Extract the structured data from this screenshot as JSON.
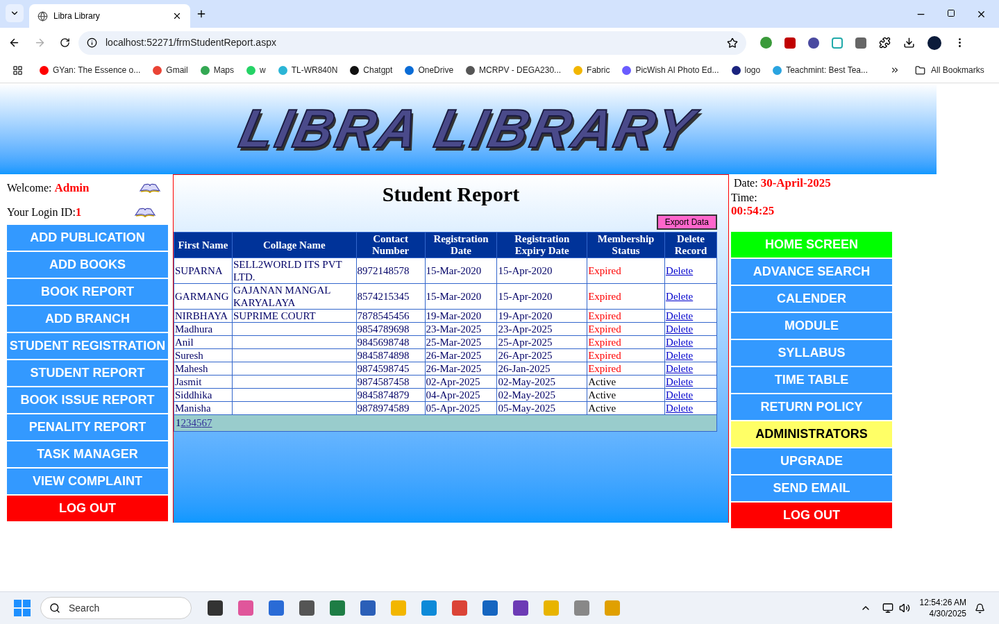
{
  "browser": {
    "tab_title": "Libra Library",
    "url": "localhost:52271/frmStudentReport.aspx",
    "bookmarks": [
      "GYan: The Essence o...",
      "Gmail",
      "Maps",
      "w",
      "TL-WR840N",
      "Chatgpt",
      "OneDrive",
      "MCRPV - DEGA230...",
      "Fabric",
      "PicWish AI Photo Ed...",
      "logo",
      "Teachmint: Best Tea..."
    ],
    "all_bookmarks": "All Bookmarks"
  },
  "banner": {
    "logo": "LIBRA LIBRARY"
  },
  "user": {
    "welcome_label": "Welcome: ",
    "welcome_name": "Admin",
    "login_label": "Your Login ID:",
    "login_id": "1"
  },
  "left_menu": [
    {
      "label": "ADD PUBLICATION",
      "kind": "nav"
    },
    {
      "label": "ADD BOOKS",
      "kind": "nav"
    },
    {
      "label": "BOOK REPORT",
      "kind": "nav"
    },
    {
      "label": "ADD BRANCH",
      "kind": "nav"
    },
    {
      "label": "STUDENT REGISTRATION",
      "kind": "nav"
    },
    {
      "label": "STUDENT REPORT",
      "kind": "nav"
    },
    {
      "label": "BOOK ISSUE REPORT",
      "kind": "nav"
    },
    {
      "label": "PENALITY REPORT",
      "kind": "nav"
    },
    {
      "label": "TASK MANAGER",
      "kind": "nav"
    },
    {
      "label": "VIEW COMPLAINT",
      "kind": "nav"
    },
    {
      "label": "LOG OUT",
      "kind": "logout"
    }
  ],
  "report": {
    "title": "Student Report",
    "export_button": "Export Data",
    "columns": [
      "First Name",
      "Collage Name",
      "Contact Number",
      "Registration Date",
      "Registration Expiry Date",
      "Membership Status",
      "Delete Record"
    ],
    "rows": [
      {
        "first_name": "SUPARNA",
        "college": "SELL2WORLD ITS PVT LTD.",
        "contact": "8972148578",
        "reg_date": "15-Mar-2020",
        "expiry": "15-Apr-2020",
        "status": "Expired",
        "expired": true,
        "action": "Delete"
      },
      {
        "first_name": "GARMANG",
        "college": "GAJANAN MANGAL KARYALAYA",
        "contact": "8574215345",
        "reg_date": "15-Mar-2020",
        "expiry": "15-Apr-2020",
        "status": "Expired",
        "expired": true,
        "action": "Delete"
      },
      {
        "first_name": "NIRBHAYA",
        "college": "SUPRIME COURT",
        "contact": "7878545456",
        "reg_date": "19-Mar-2020",
        "expiry": "19-Apr-2020",
        "status": "Expired",
        "expired": true,
        "action": "Delete"
      },
      {
        "first_name": "Madhura",
        "contact": "9854789698",
        "reg_date": "23-Mar-2025",
        "expiry": "23-Apr-2025",
        "status": "Expired",
        "expired": true,
        "action": "Delete"
      },
      {
        "first_name": "Anil",
        "contact": "9845698748",
        "reg_date": "25-Mar-2025",
        "expiry": "25-Apr-2025",
        "status": "Expired",
        "expired": true,
        "action": "Delete"
      },
      {
        "first_name": "Suresh",
        "contact": "9845874898",
        "reg_date": "26-Mar-2025",
        "expiry": "26-Apr-2025",
        "status": "Expired",
        "expired": true,
        "action": "Delete"
      },
      {
        "first_name": "Mahesh",
        "contact": "9874598745",
        "reg_date": "26-Mar-2025",
        "expiry": "26-Jan-2025",
        "status": "Expired",
        "expired": true,
        "action": "Delete"
      },
      {
        "first_name": "Jasmit",
        "contact": "9874587458",
        "reg_date": "02-Apr-2025",
        "expiry": "02-May-2025",
        "status": "Active",
        "expired": false,
        "action": "Delete"
      },
      {
        "first_name": "Siddhika",
        "contact": "9845874879",
        "reg_date": "04-Apr-2025",
        "expiry": "02-May-2025",
        "status": "Active",
        "expired": false,
        "action": "Delete"
      },
      {
        "first_name": "Manisha",
        "contact": "9878974589",
        "reg_date": "05-Apr-2025",
        "expiry": "05-May-2025",
        "status": "Active",
        "expired": false,
        "action": "Delete"
      }
    ],
    "pages": [
      {
        "label": "1",
        "selected": true
      },
      {
        "label": "2",
        "selected": false
      },
      {
        "label": "3",
        "selected": false
      },
      {
        "label": "4",
        "selected": false
      },
      {
        "label": "5",
        "selected": false
      },
      {
        "label": "6",
        "selected": false
      },
      {
        "label": "7",
        "selected": false
      }
    ]
  },
  "clock": {
    "date_label": "Date: ",
    "date": "30-April-2025",
    "time_label": "Time:",
    "time": "00:54:25"
  },
  "right_menu": [
    {
      "label": "HOME SCREEN",
      "kind": "home"
    },
    {
      "label": "ADVANCE SEARCH",
      "kind": "nav"
    },
    {
      "label": "CALENDER",
      "kind": "nav"
    },
    {
      "label": "MODULE",
      "kind": "nav"
    },
    {
      "label": "SYLLABUS",
      "kind": "nav"
    },
    {
      "label": "TIME TABLE",
      "kind": "nav"
    },
    {
      "label": "RETURN POLICY",
      "kind": "nav"
    },
    {
      "label": "ADMINISTRATORS",
      "kind": "admin"
    },
    {
      "label": "UPGRADE",
      "kind": "nav"
    },
    {
      "label": "SEND EMAIL",
      "kind": "nav"
    },
    {
      "label": "LOG OUT",
      "kind": "logout"
    }
  ],
  "taskbar": {
    "search_placeholder": "Search",
    "time": "12:54:26 AM",
    "date": "4/30/2025"
  }
}
